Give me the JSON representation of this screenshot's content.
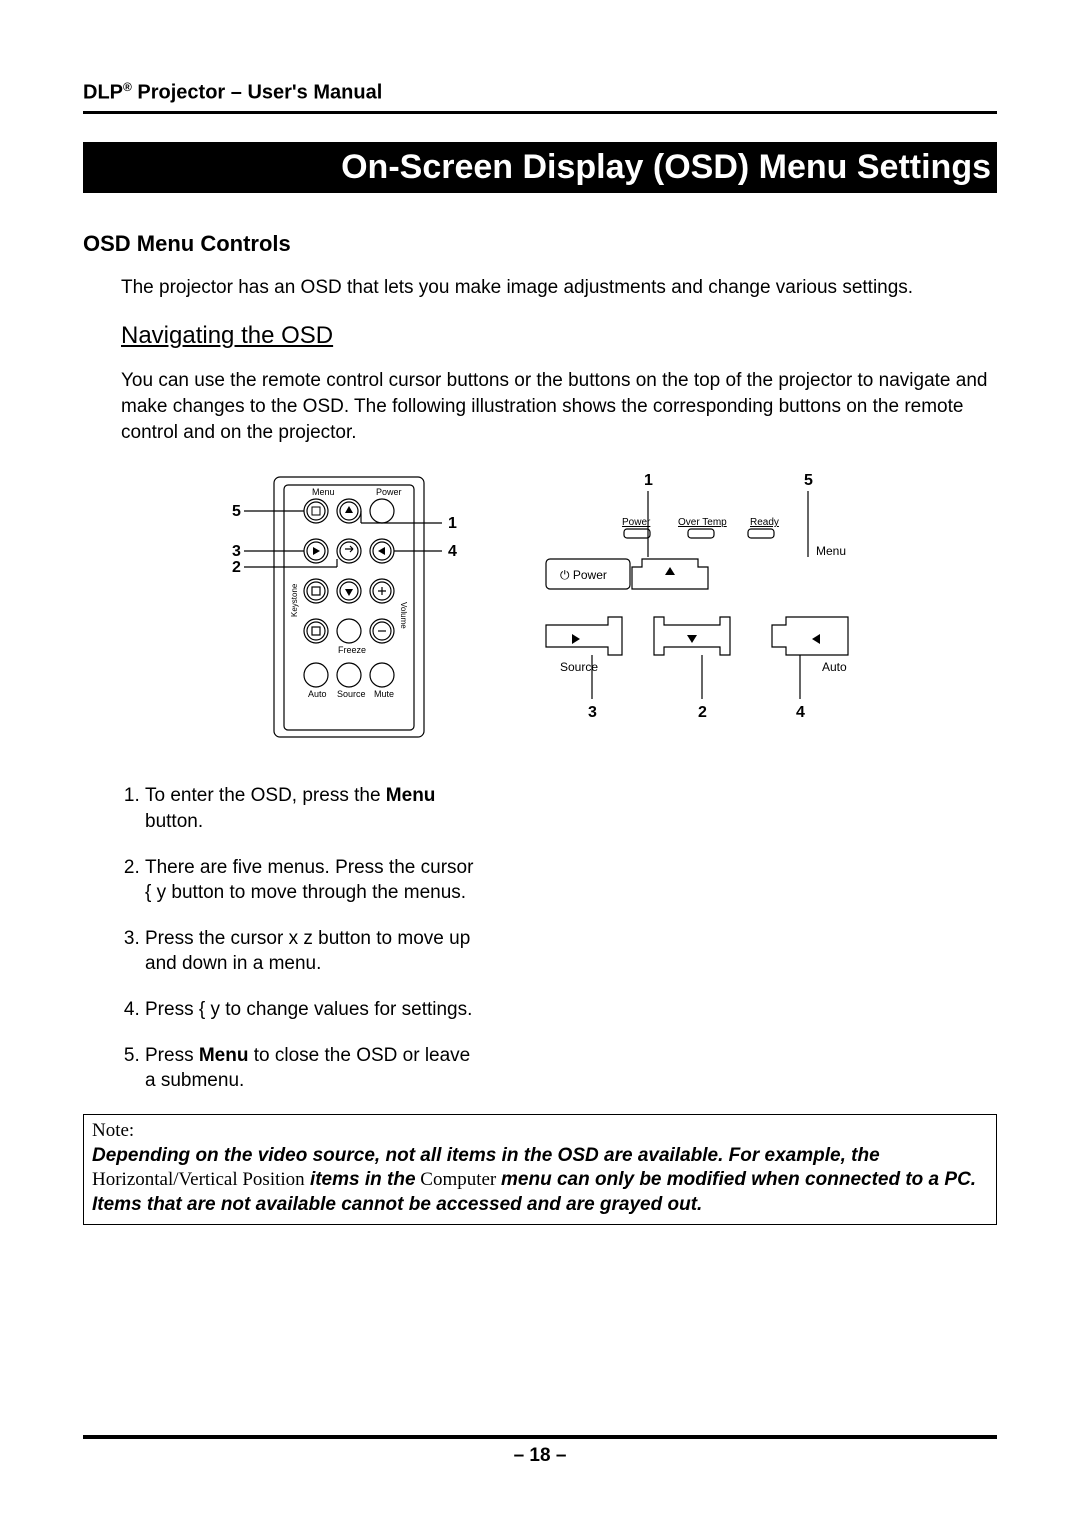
{
  "header": {
    "brand": "DLP",
    "reg": "®",
    "product": "Projector – User's Manual"
  },
  "chapterTitle": "On-Screen Display (OSD) Menu Settings",
  "section": {
    "h2": "OSD Menu Controls",
    "intro": "The projector has an OSD that lets you make image adjustments and change various settings.",
    "h3": "Navigating the OSD",
    "navPara": "You can use the remote control cursor buttons or the buttons on the top of the projector to navigate and make changes to the OSD. The following illustration shows the corresponding buttons on the remote control and on the projector."
  },
  "remoteLabels": {
    "menu": "Menu",
    "power": "Power",
    "keystone": "Keystone",
    "volume": "Volume",
    "freeze": "Freeze",
    "auto": "Auto",
    "source": "Source",
    "mute": "Mute"
  },
  "panelLabels": {
    "power": "Power",
    "overTemp": "Over Temp",
    "ready": "Ready",
    "menu": "Menu",
    "source": "Source",
    "auto": "Auto",
    "powerBtn": "Power",
    "powerGlyph": "⏻"
  },
  "callouts": {
    "remote": {
      "c1": "1",
      "c2": "2",
      "c3": "3",
      "c4": "4",
      "c5": "5"
    },
    "panel": {
      "c1": "1",
      "c2": "2",
      "c3": "3",
      "c4": "4",
      "c5": "5"
    }
  },
  "steps": {
    "s1a": "To enter the OSD, press the ",
    "s1b": "Menu",
    "s1c": " button.",
    "s2": "There are five menus. Press the cursor  { y   button to move through the menus.",
    "s3": "Press the cursor  x z   button to move up and down in a menu.",
    "s4": "Press  { y   to change values for settings.",
    "s5a": "Press ",
    "s5b": "Menu",
    "s5c": " to close the OSD or leave a submenu."
  },
  "note": {
    "label": "Note:",
    "t1": "Depending on the video source, not all items in the OSD are available.",
    "sp1": "     ",
    "t2": "For example, the",
    "sp2": "   ",
    "rm1": "Horizontal/Vertical Position",
    "sp3": "       ",
    "t3": "items in the",
    "rm2": " Computer    ",
    "t4": "menu can only be modified when connected to a PC. Items that are not available cannot be accessed and are grayed out."
  },
  "page": "– 18 –"
}
